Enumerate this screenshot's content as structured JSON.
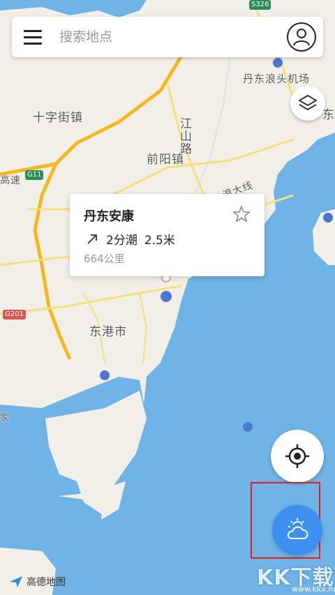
{
  "search": {
    "placeholder": "搜索地点"
  },
  "map": {
    "labels": {
      "airport": "丹东浪头机场",
      "shizijie": "十字街镇",
      "jiangshan_road": "江山路",
      "qianyang": "前阳镇",
      "donggang": "东港市",
      "dandong_partial": "东",
      "lang_road": "浪大线",
      "highway_partial": "高速",
      "east_edge": "家"
    },
    "road_tags": {
      "s326": "S326",
      "g11": "G11",
      "g201": "G201"
    }
  },
  "tide_popup": {
    "place": "丹东安康",
    "trend": "2分潮",
    "height": "2.5米",
    "distance": "664公里"
  },
  "logo": {
    "text": "高德地图"
  },
  "watermark": {
    "text": "KK下载",
    "url": "www.kkx.net"
  },
  "colors": {
    "water": "#6fb3e7",
    "land": "#f2efe9",
    "highway": "#f4b81c",
    "accent_blue": "#3d8ff0",
    "highlight_red": "#e02020"
  }
}
